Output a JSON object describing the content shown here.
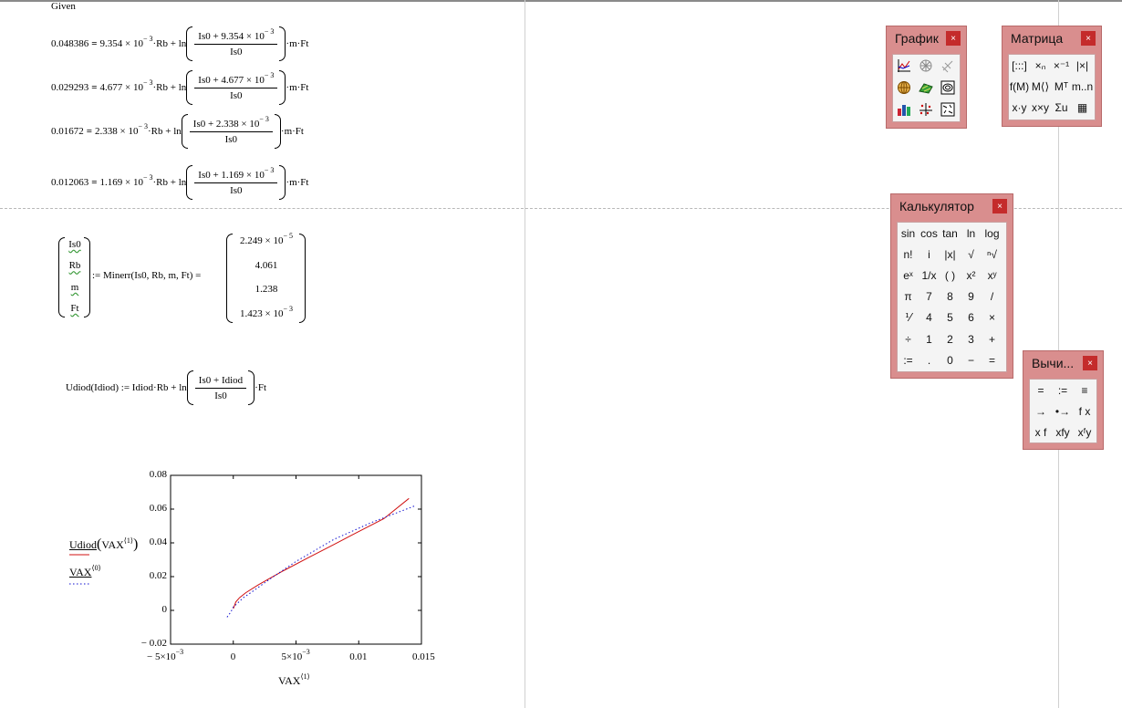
{
  "given": "Given",
  "equations": [
    {
      "lhs": "0.048386",
      "coef": "9.354 × 10",
      "exp": "− 3",
      "term": "·Rb + ln",
      "num": "Is0 + 9.354 × 10",
      "numexp": "− 3",
      "den": "Is0",
      "tail": "·m·Ft"
    },
    {
      "lhs": "0.029293",
      "coef": "4.677 × 10",
      "exp": "− 3",
      "term": "·Rb + ln",
      "num": "Is0 + 4.677 × 10",
      "numexp": "− 3",
      "den": "Is0",
      "tail": "·m·Ft"
    },
    {
      "lhs": "0.01672",
      "coef": "2.338 × 10",
      "exp": "− 3",
      "term": "·Rb + ln",
      "num": "Is0 + 2.338 × 10",
      "numexp": "− 3",
      "den": "Is0",
      "tail": "·m·Ft"
    },
    {
      "lhs": "0.012063",
      "coef": "1.169 × 10",
      "exp": "− 3",
      "term": "·Rb + ln",
      "num": "Is0 + 1.169 × 10",
      "numexp": "− 3",
      "den": "Is0",
      "tail": "·m·Ft"
    }
  ],
  "minerr": {
    "vars": [
      "Is0",
      "Rb",
      "m",
      "Ft"
    ],
    "call": ":= Minerr(Is0, Rb, m, Ft) =",
    "results": [
      {
        "base": "2.249 × 10",
        "exp": "− 5"
      },
      {
        "base": "4.061",
        "exp": ""
      },
      {
        "base": "1.238",
        "exp": ""
      },
      {
        "base": "1.423 × 10",
        "exp": "− 3"
      }
    ]
  },
  "udiod": {
    "lhs": "Udiod(Idiod) := Idiod·Rb + ln",
    "num": "Is0 + Idiod",
    "den": "Is0",
    "tail": "·Ft"
  },
  "chart_data": {
    "type": "line",
    "title": "",
    "xlabel": "VAX",
    "xlabel_sup": "⟨1⟩",
    "ylim": [
      -0.02,
      0.08
    ],
    "xlim": [
      -0.005,
      0.015
    ],
    "yticks": [
      "0.08",
      "0.06",
      "0.04",
      "0.02",
      "0",
      "− 0.02"
    ],
    "xticks": [
      {
        "base": "− 5×10",
        "exp": "−3"
      },
      {
        "base": "0",
        "exp": ""
      },
      {
        "base": "5×10",
        "exp": "−3"
      },
      {
        "base": "0.01",
        "exp": ""
      },
      {
        "base": "0.015",
        "exp": ""
      }
    ],
    "legend": [
      {
        "name": "Udiod",
        "arg": "VAX",
        "sup": "⟨1⟩",
        "color": "#d01010",
        "style": "solid"
      },
      {
        "name": "VAX",
        "arg": "",
        "sup": "⟨0⟩",
        "color": "#1010d0",
        "style": "dotted"
      }
    ],
    "series": [
      {
        "name": "Udiod(VAX⟨1⟩)",
        "color": "#d01010",
        "x": [
          0,
          0.0002,
          0.0005,
          0.001,
          0.002,
          0.004,
          0.006,
          0.008,
          0.01,
          0.012,
          0.014
        ],
        "y": [
          0.001,
          0.005,
          0.0075,
          0.0105,
          0.0152,
          0.0235,
          0.0313,
          0.039,
          0.0467,
          0.0543,
          0.0663
        ]
      },
      {
        "name": "VAX⟨0⟩",
        "color": "#1010d0",
        "x": [
          -0.0005,
          -0.0002,
          0,
          0.0003,
          0.0008,
          0.0015,
          0.003,
          0.005,
          0.008,
          0.011,
          0.0145
        ],
        "y": [
          -0.004,
          -0.001,
          0.002,
          0.004,
          0.0075,
          0.011,
          0.019,
          0.029,
          0.042,
          0.052,
          0.062
        ]
      }
    ]
  },
  "palettes": {
    "graph": {
      "title": "График",
      "close": "×"
    },
    "matrix": {
      "title": "Матрица",
      "close": "×",
      "keys": [
        "[:::]",
        "×ₙ",
        "×⁻¹",
        "|×|",
        "f(M)",
        "M⟨⟩",
        "Mᵀ",
        "m..n",
        "x·y",
        "x×y",
        "Σu",
        "▦"
      ]
    },
    "calc": {
      "title": "Калькулятор",
      "close": "×",
      "keys": [
        "sin",
        "cos",
        "tan",
        "ln",
        "log",
        "n!",
        "i",
        "|x|",
        "√",
        "ⁿ√",
        "eˣ",
        "1/x",
        "( )",
        "x²",
        "xʸ",
        "π",
        "7",
        "8",
        "9",
        "/",
        "⅟",
        "4",
        "5",
        "6",
        "×",
        "÷",
        "1",
        "2",
        "3",
        "+",
        ":=",
        ".",
        "0",
        "−",
        "="
      ]
    },
    "eval": {
      "title": "Вычи...",
      "close": "×",
      "keys": [
        "=",
        ":=",
        "≡",
        "→",
        "•→",
        "f x",
        "x f",
        "xfy",
        "xᶠy"
      ]
    }
  }
}
